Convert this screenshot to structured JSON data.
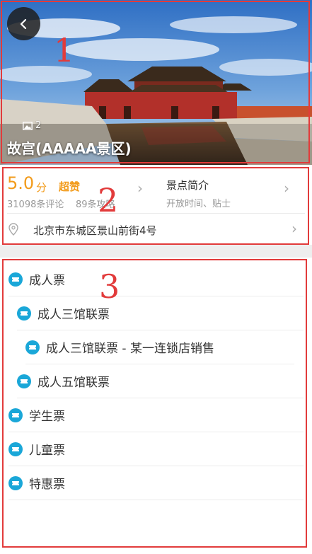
{
  "hero": {
    "photo_count": "2",
    "title": "故宫(AAAAA景区)",
    "icons": {
      "back": "back-chevron-icon",
      "photos": "image-icon"
    }
  },
  "summary": {
    "score": "5.0",
    "score_unit": "分",
    "praise": "超赞",
    "reviews": "31098条评论",
    "guides": "89条攻略",
    "intro_title": "景点简介",
    "intro_sub": "开放时间、贴士",
    "address": "北京市东城区景山前街4号",
    "icons": {
      "location": "location-pin-icon",
      "chevron": "chevron-right-icon"
    }
  },
  "tickets": [
    {
      "label": "成人票",
      "level": 0
    },
    {
      "label": "成人三馆联票",
      "level": 1
    },
    {
      "label": "成人三馆联票 - 某一连锁店销售",
      "level": 2
    },
    {
      "label": "成人五馆联票",
      "level": 1
    },
    {
      "label": "学生票",
      "level": 0
    },
    {
      "label": "儿童票",
      "level": 0
    },
    {
      "label": "特惠票",
      "level": 0
    }
  ],
  "annotations": [
    "1",
    "2",
    "3"
  ],
  "colors": {
    "accent": "#f29b1b",
    "ticket_icon": "#1aa7d8",
    "annotation": "#e23b3b"
  }
}
